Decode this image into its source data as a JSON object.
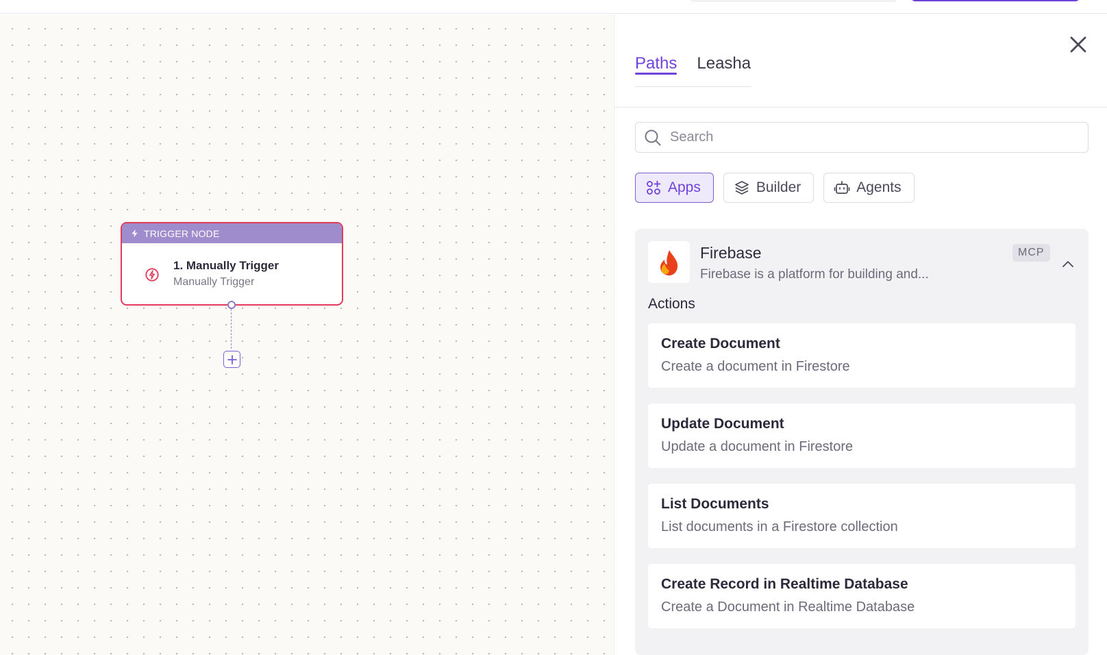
{
  "canvas": {
    "trigger_node": {
      "header_label": "TRIGGER NODE",
      "title": "1. Manually Trigger",
      "subtitle": "Manually Trigger"
    }
  },
  "panel": {
    "tabs": [
      {
        "label": "Paths",
        "active": true
      },
      {
        "label": "Leasha",
        "active": false
      }
    ],
    "search": {
      "placeholder": "Search",
      "value": ""
    },
    "filters": [
      {
        "label": "Apps",
        "icon": "apps-icon",
        "active": true
      },
      {
        "label": "Builder",
        "icon": "builder-icon",
        "active": false
      },
      {
        "label": "Agents",
        "icon": "robot-icon",
        "active": false
      }
    ],
    "app": {
      "name": "Firebase",
      "description": "Firebase is a platform for building and...",
      "badge": "MCP",
      "actions_heading": "Actions",
      "actions": [
        {
          "title": "Create Document",
          "description": "Create a document in Firestore"
        },
        {
          "title": "Update Document",
          "description": "Update a document in Firestore"
        },
        {
          "title": "List Documents",
          "description": "List documents in a Firestore collection"
        },
        {
          "title": "Create Record in Realtime Database",
          "description": "Create a Document in Realtime Database"
        }
      ]
    }
  },
  "colors": {
    "accent": "#6f42d9",
    "trigger_border": "#e23b5a",
    "trigger_header": "#9f8ccd"
  }
}
